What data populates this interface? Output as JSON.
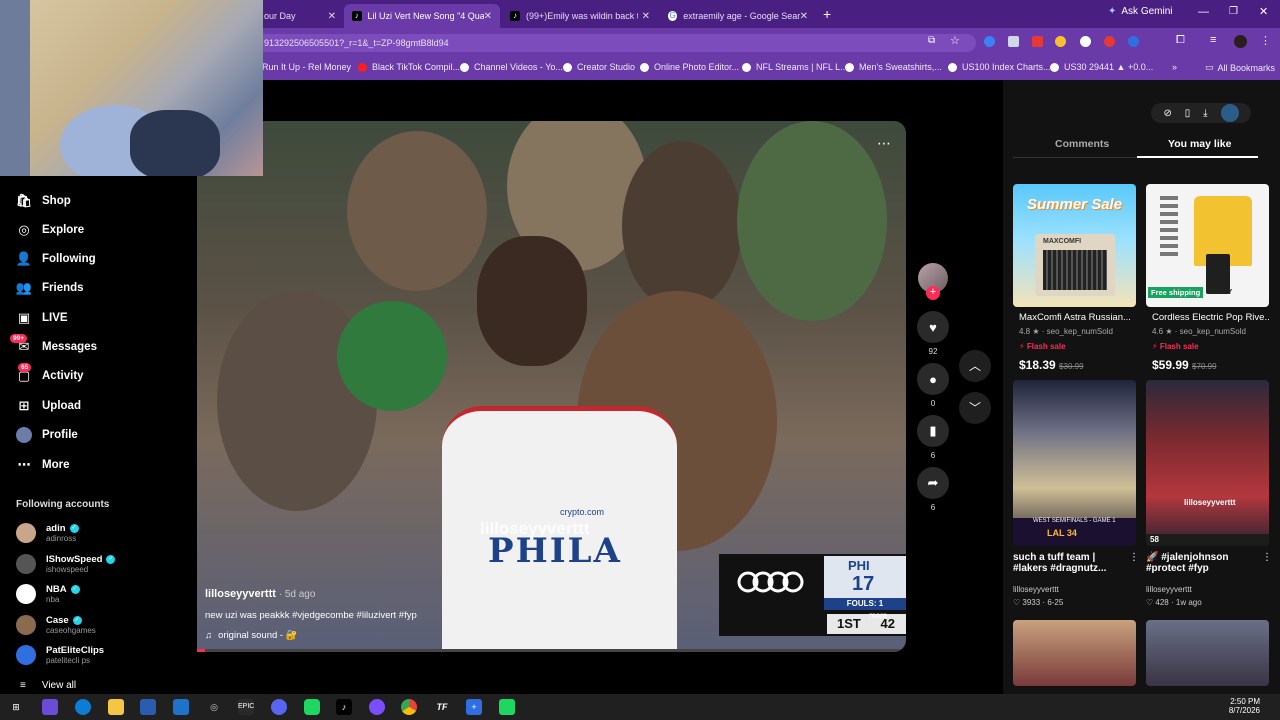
{
  "browser": {
    "tabs": [
      {
        "title": "our Day",
        "active": false
      },
      {
        "title": "Lil Uzi Vert New Song \"4 Quak",
        "active": true
      },
      {
        "title": "(99+)Emily was wildin back the",
        "active": false
      },
      {
        "title": "extraemily age - Google Search",
        "active": false
      }
    ],
    "gemini": "Ask Gemini",
    "url": "913292506505501?_r=1&_t=ZP-98gmtB8ld94",
    "bookmarks": [
      "Run It Up - Rel Money",
      "Black TikTok Compil...",
      "Channel Videos - Yo...",
      "Creator Studio",
      "Online Photo Editor...",
      "NFL Streams | NFL L...",
      "Men's Sweatshirts,...",
      "US100 Index Charts...",
      "US30 29441 ▲ +0.0...",
      "All Bookmarks"
    ]
  },
  "sidebar": {
    "items": [
      {
        "label": "Shop",
        "icon": "shop-icon"
      },
      {
        "label": "Explore",
        "icon": "compass-icon"
      },
      {
        "label": "Following",
        "icon": "following-icon"
      },
      {
        "label": "Friends",
        "icon": "friends-icon"
      },
      {
        "label": "LIVE",
        "icon": "live-icon"
      },
      {
        "label": "Messages",
        "icon": "messages-icon",
        "badge": "99+"
      },
      {
        "label": "Activity",
        "icon": "activity-icon",
        "badge": "65"
      },
      {
        "label": "Upload",
        "icon": "upload-icon"
      },
      {
        "label": "Profile",
        "icon": "profile-icon"
      },
      {
        "label": "More",
        "icon": "more-icon"
      }
    ],
    "following_heading": "Following accounts",
    "accounts": [
      {
        "name": "adin",
        "handle": "adinross"
      },
      {
        "name": "IShowSpeed",
        "handle": "ishowspeed"
      },
      {
        "name": "NBA",
        "handle": "nba"
      },
      {
        "name": "Case",
        "handle": "caseohgames"
      },
      {
        "name": "PatEliteClips",
        "handle": "patelitecli ps"
      }
    ],
    "view_all": "View all"
  },
  "video": {
    "author": "lilloseyyverttt",
    "age": "5d ago",
    "caption": "new uzi was peakkk #vjedgecombe #liluzivert #fyp",
    "sound": "original sound - 🔐",
    "watermark": "lilloseyyverttt",
    "more": "more",
    "scoreboard": {
      "team": "PHI",
      "score": "17",
      "fouls": "FOULS: 1",
      "period": "1ST",
      "clock": "42"
    },
    "jersey_text": "PHILA",
    "sponsor": "crypto.com"
  },
  "actions": {
    "likes": "92",
    "comments": "0",
    "saves": "6",
    "shares": "6"
  },
  "right_panel": {
    "tabs": [
      "Comments",
      "You may like"
    ],
    "active_tab": "You may like",
    "products": [
      {
        "title": "MaxComfi Astra Russian...",
        "rating": "4.8",
        "sold": "seo_kep_numSold",
        "flash": "Flash sale",
        "price": "$18.39",
        "old_price": "$30.99",
        "banner": "Summer Sale",
        "brand": "MAXCOMFI"
      },
      {
        "title": "Cordless Electric Pop Rive...",
        "rating": "4.6",
        "sold": "seo_kep_numSold",
        "flash": "Flash sale",
        "price": "$59.99",
        "old_price": "$70.99",
        "banner": "Free shipping",
        "brand": "TTERY"
      }
    ],
    "videos": [
      {
        "title1": "such a tuff team |",
        "title2": "#lakers #dragnutz...",
        "author": "lilloseyyverttt",
        "likes": "3933",
        "date": "6-25",
        "overlay": "WEST SEMIFINALS - GAME 1",
        "score": "LAL 34"
      },
      {
        "title1": "🚀 #jalenjohnson",
        "title2": "#protect #fyp",
        "author": "lilloseyyverttt",
        "likes": "428",
        "date": "1w ago",
        "overlay": "lilloseyyverttt",
        "score": "58"
      }
    ]
  },
  "taskbar": {
    "time": "2:50 PM",
    "date": "8/7/2026"
  }
}
